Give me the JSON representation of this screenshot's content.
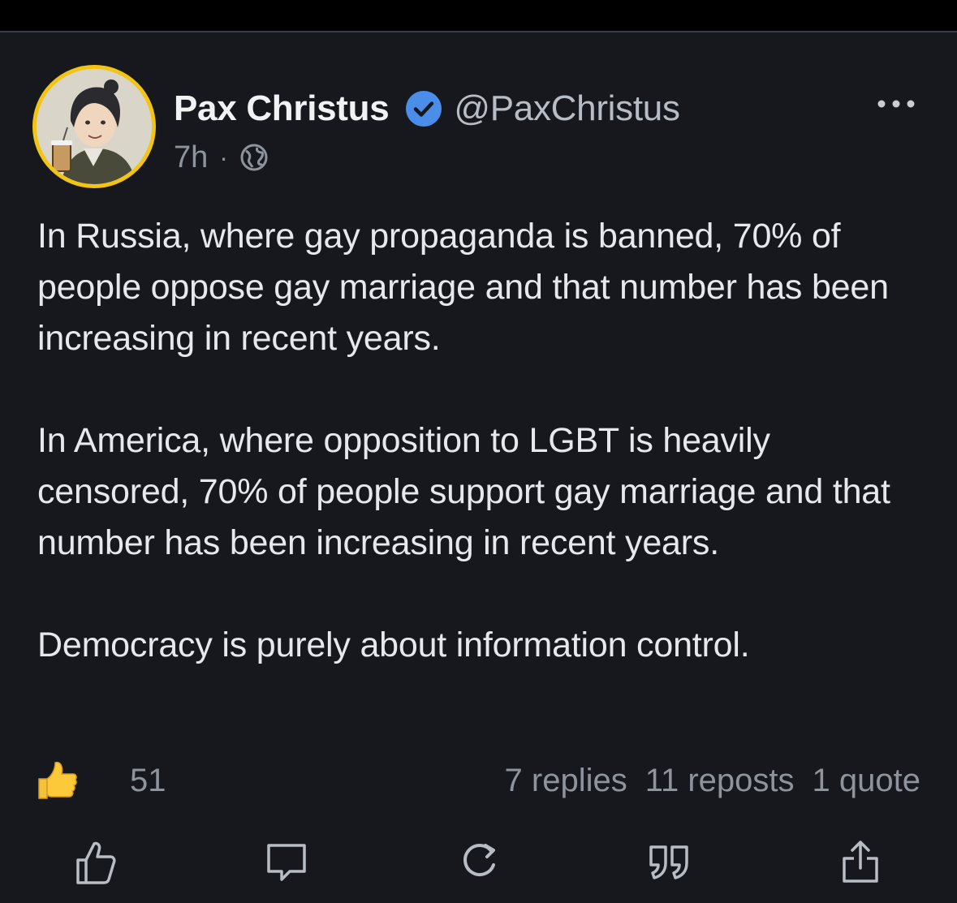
{
  "post": {
    "display_name": "Pax Christus",
    "handle": "@PaxChristus",
    "time": "7h",
    "separator": "·",
    "verified_icon": "verified-check-icon",
    "visibility_icon": "globe-icon",
    "body": [
      "In Russia, where gay propaganda is banned, 70% of people oppose gay marriage and that number has been increasing in recent years.",
      "In America, where opposition to LGBT is heavily censored, 70% of people support gay marriage and that number has been increasing in recent years.",
      "Democracy is purely about information control."
    ]
  },
  "stats": {
    "like_count": "51",
    "replies": "7 replies",
    "reposts": "11 reposts",
    "quotes": "1 quote"
  },
  "actions": [
    "like-icon",
    "reply-icon",
    "repost-icon",
    "quote-icon",
    "share-icon"
  ],
  "colors": {
    "background": "#16181d",
    "avatar_ring": "#f2c413",
    "verified_badge": "#4a8eea",
    "text": "#e6e8ec",
    "muted": "#8e939c"
  }
}
